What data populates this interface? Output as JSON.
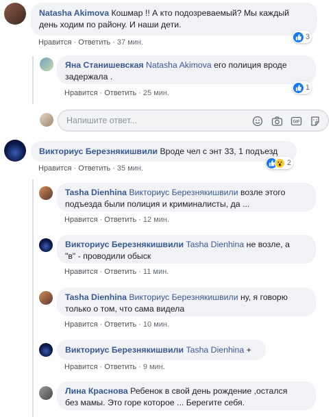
{
  "actions": {
    "like": "Нравится",
    "reply": "Ответить",
    "sep": "·"
  },
  "comments": [
    {
      "author": "Natasha Akimova",
      "text_line1": "Кошмар !! А кто подозреваемый? Мы каждый",
      "text_line2": "день ходим по району. И наши дети.",
      "time": "37 мин.",
      "reactions": "3"
    },
    {
      "author": "Яна Станишевская",
      "mention": "Natasha Akimova",
      "text_line1": "его полиция вроде",
      "text_line2": "задержала .",
      "time": "25 мин.",
      "reactions": "1"
    },
    {
      "author": "Викториус Березнякишвили",
      "text_line1": "Вроде чел с энт 33, 1 подъезд",
      "time": "35 мин.",
      "reactions": "2"
    },
    {
      "author": "Tasha Dienhina",
      "mention": "Викториус Березнякишвили",
      "text_line1": "возле этого",
      "text_line2": "подъезда были полиция и криминалисты, да ...",
      "time": "12 мин."
    },
    {
      "author": "Викториус Березнякишвили",
      "mention": "Tasha Dienhina",
      "text_line1": "не возле, а",
      "text_line2": "\"в\" - проводили обыск",
      "time": "11 мин."
    },
    {
      "author": "Tasha Dienhina",
      "mention": "Викториус Березнякишвили",
      "text_line1": "ну, я говорю",
      "text_line2": "только о том, что сама видела",
      "time": "10 мин."
    },
    {
      "author": "Викториус Березнякишвили",
      "mention": "Tasha Dienhina",
      "text_line1": "+",
      "time": "9 мин."
    },
    {
      "author": "Лина Краснова",
      "text_line1": "Ребенок в свой день рождение ,остался",
      "text_line2": "без мамы. Это горе которое ... Берегите себя."
    }
  ],
  "reply_input": {
    "placeholder": "Напишите ответ..."
  },
  "icons": [
    "like-icon",
    "wow-icon",
    "smiley-icon",
    "camera-icon",
    "gif-icon",
    "sticker-icon"
  ]
}
